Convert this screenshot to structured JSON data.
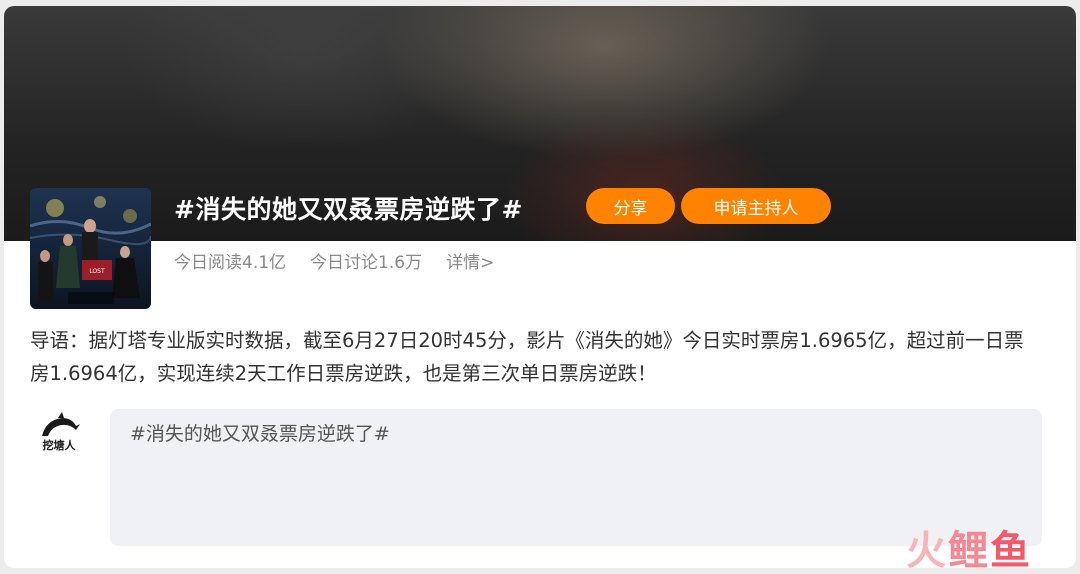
{
  "topic": {
    "title": "#消失的她又双叒票房逆跌了#",
    "share_label": "分享",
    "host_label": "申请主持人"
  },
  "stats": {
    "reads": "今日阅读4.1亿",
    "discussions": "今日讨论1.6万",
    "detail": "详情>"
  },
  "intro": {
    "text": "导语：据灯塔专业版实时数据，截至6月27日20时45分，影片《消失的她》今日实时票房1.6965亿，超过前一日票房1.6964亿，实现连续2天工作日票房逆跌，也是第三次单日票房逆跌！"
  },
  "brand": {
    "name": "挖塘人"
  },
  "composer": {
    "value": "#消失的她又双叒票房逆跌了#"
  },
  "watermark": {
    "c1": "火",
    "c2": "鲤",
    "c3": "鱼"
  },
  "colors": {
    "accent": "#ff8200",
    "watermark": "#f05a6b"
  }
}
